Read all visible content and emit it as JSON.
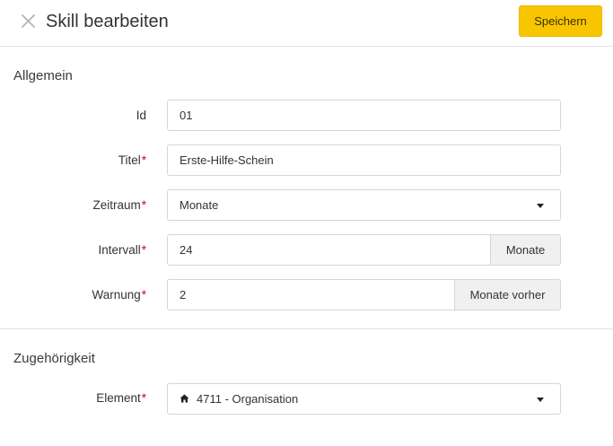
{
  "header": {
    "title": "Skill bearbeiten",
    "save_label": "Speichern"
  },
  "sections": {
    "general": "Allgemein",
    "belonging": "Zugehörigkeit"
  },
  "fields": {
    "id": {
      "label": "Id",
      "value": "01"
    },
    "title": {
      "label": "Titel",
      "value": "Erste-Hilfe-Schein",
      "required": "*"
    },
    "period": {
      "label": "Zeitraum",
      "value": "Monate",
      "required": "*"
    },
    "interval": {
      "label": "Intervall",
      "value": "24",
      "addon": "Monate",
      "required": "*"
    },
    "warning": {
      "label": "Warnung",
      "value": "2",
      "addon": "Monate vorher",
      "required": "*"
    },
    "element": {
      "label": "Element",
      "value": "4711 - Organisation",
      "required": "*"
    }
  },
  "colors": {
    "accent": "#f7c600",
    "required": "#d0021b"
  },
  "icons": {
    "close": "close-icon",
    "home": "home-icon",
    "caret": "chevron-down-icon"
  }
}
